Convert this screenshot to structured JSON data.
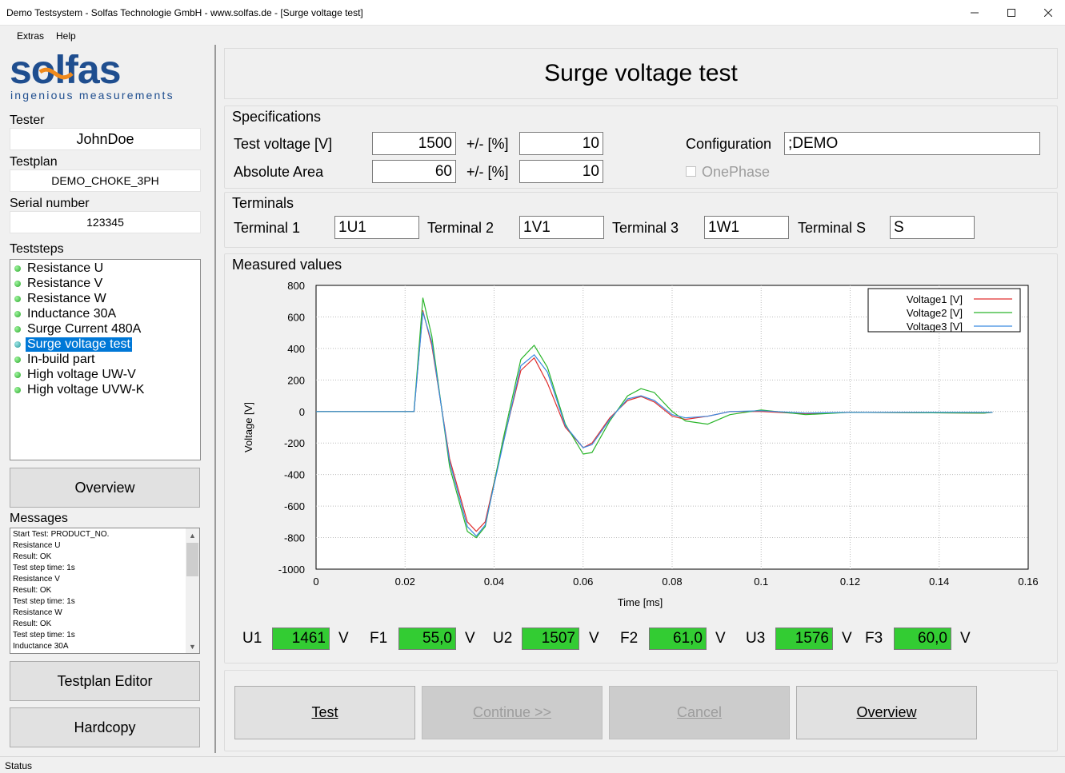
{
  "window": {
    "title": "Demo Testsystem - Solfas Technologie GmbH - www.solfas.de - [Surge voltage test]",
    "min_icon": "minimize-icon",
    "max_icon": "maximize-icon",
    "close_icon": "close-icon"
  },
  "menu": {
    "items": [
      "Extras",
      "Help"
    ]
  },
  "logo": {
    "brand": "solfas",
    "tagline": "ingenious measurements",
    "colors": {
      "blue": "#1f4e8f",
      "orange": "#f08a1c"
    }
  },
  "left": {
    "tester_label": "Tester",
    "tester_value": "JohnDoe",
    "testplan_label": "Testplan",
    "testplan_value": "DEMO_CHOKE_3PH",
    "serial_label": "Serial number",
    "serial_value": "123345",
    "teststeps_label": "Teststeps",
    "steps": [
      "Resistance U",
      "Resistance V",
      "Resistance W",
      "Inductance 30A",
      "Surge Current 480A",
      "Surge voltage test",
      "In-build part",
      "High voltage UW-V",
      "High voltage UVW-K"
    ],
    "selected_step": "Surge voltage test",
    "overview_button": "Overview",
    "messages_label": "Messages",
    "messages": [
      "Start Test: PRODUCT_NO.",
      "Resistance U",
      "Result: OK",
      "Test step time: 1s",
      "Resistance V",
      "Result: OK",
      "Test step time: 1s",
      "Resistance W",
      "Result: OK",
      "Test step time: 1s",
      "Inductance 30A"
    ],
    "testplan_editor_button": "Testplan Editor",
    "hardcopy_button": "Hardcopy"
  },
  "main": {
    "heading": "Surge voltage test",
    "specifications": {
      "title": "Specifications",
      "test_voltage_label": "Test voltage [V]",
      "test_voltage_value": "1500",
      "tol_label_1": "+/- [%]",
      "tol_value_1": "10",
      "area_label": "Absolute Area",
      "area_value": "60",
      "tol_label_2": "+/- [%]",
      "tol_value_2": "10",
      "config_label": "Configuration",
      "config_value": ";DEMO",
      "onephase_label": "OnePhase"
    },
    "terminals": {
      "title": "Terminals",
      "t1_label": "Terminal 1",
      "t1_value": "1U1",
      "t2_label": "Terminal 2",
      "t2_value": "1V1",
      "t3_label": "Terminal 3",
      "t3_value": "1W1",
      "ts_label": "Terminal S",
      "ts_value": "S"
    },
    "measured": {
      "title": "Measured values",
      "readouts": [
        {
          "label": "U1",
          "value": "1461",
          "unit": "V"
        },
        {
          "label": "F1",
          "value": "55,0",
          "unit": "V"
        },
        {
          "label": "U2",
          "value": "1507",
          "unit": "V"
        },
        {
          "label": "F2",
          "value": "61,0",
          "unit": "V"
        },
        {
          "label": "U3",
          "value": "1576",
          "unit": "V"
        },
        {
          "label": "F3",
          "value": "60,0",
          "unit": "V"
        }
      ]
    },
    "buttons": {
      "test": "Test",
      "continue": "Continue >>",
      "cancel": "Cancel",
      "overview": "Overview"
    }
  },
  "status": "Status",
  "chart_data": {
    "type": "line",
    "title": "",
    "xlabel": "Time [ms]",
    "ylabel": "Voltage [V]",
    "xlim": [
      0,
      0.16
    ],
    "ylim": [
      -1000,
      800
    ],
    "xticks": [
      "0",
      "0.02",
      "0.04",
      "0.06",
      "0.08",
      "0.1",
      "0.12",
      "0.14",
      "0.16"
    ],
    "yticks": [
      "800",
      "600",
      "400",
      "200",
      "0",
      "-200",
      "-400",
      "-600",
      "-800",
      "-1000"
    ],
    "grid": true,
    "legend_position": "top-right",
    "series": [
      {
        "name": "Voltage1 [V]",
        "color": "#e03030",
        "x": [
          0,
          0.022,
          0.024,
          0.026,
          0.03,
          0.034,
          0.036,
          0.038,
          0.042,
          0.046,
          0.049,
          0.052,
          0.056,
          0.06,
          0.062,
          0.066,
          0.07,
          0.073,
          0.076,
          0.08,
          0.083,
          0.088,
          0.093,
          0.1,
          0.11,
          0.12,
          0.15,
          0.152
        ],
        "y": [
          0,
          0,
          640,
          420,
          -300,
          -700,
          -760,
          -700,
          -200,
          260,
          340,
          180,
          -100,
          -230,
          -200,
          -40,
          70,
          95,
          60,
          -30,
          -50,
          -30,
          0,
          0,
          -15,
          -5,
          -10,
          -5
        ]
      },
      {
        "name": "Voltage2 [V]",
        "color": "#2ab52a",
        "x": [
          0,
          0.022,
          0.024,
          0.026,
          0.03,
          0.034,
          0.036,
          0.038,
          0.042,
          0.046,
          0.049,
          0.052,
          0.056,
          0.06,
          0.062,
          0.066,
          0.07,
          0.073,
          0.076,
          0.08,
          0.083,
          0.088,
          0.093,
          0.1,
          0.11,
          0.12,
          0.15,
          0.152
        ],
        "y": [
          0,
          0,
          720,
          480,
          -350,
          -760,
          -800,
          -730,
          -180,
          330,
          420,
          280,
          -80,
          -270,
          -260,
          -60,
          100,
          145,
          120,
          0,
          -60,
          -80,
          -20,
          10,
          -20,
          -5,
          -10,
          -5
        ]
      },
      {
        "name": "Voltage3 [V]",
        "color": "#3a8ae0",
        "x": [
          0,
          0.022,
          0.024,
          0.026,
          0.03,
          0.034,
          0.036,
          0.038,
          0.042,
          0.046,
          0.049,
          0.052,
          0.056,
          0.06,
          0.062,
          0.066,
          0.07,
          0.073,
          0.076,
          0.08,
          0.083,
          0.088,
          0.093,
          0.1,
          0.11,
          0.12,
          0.15,
          0.152
        ],
        "y": [
          0,
          0,
          630,
          440,
          -320,
          -730,
          -790,
          -720,
          -210,
          290,
          360,
          250,
          -90,
          -230,
          -210,
          -50,
          80,
          100,
          70,
          -20,
          -40,
          -30,
          0,
          5,
          -10,
          -5,
          -5,
          -5
        ]
      }
    ]
  }
}
